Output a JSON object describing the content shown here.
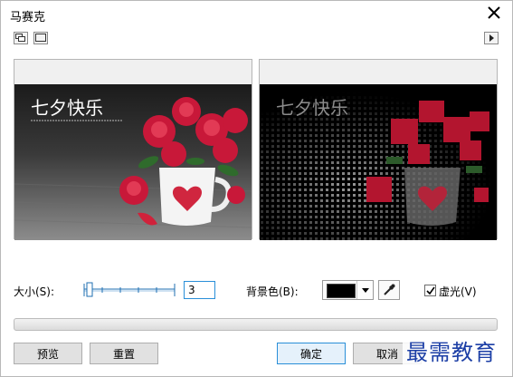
{
  "window": {
    "title": "马赛克"
  },
  "preview_left": {
    "overlay_text": "七夕快乐"
  },
  "preview_right": {
    "overlay_text": "七夕快乐"
  },
  "controls": {
    "size_label": "大小(S):",
    "size_value": "3",
    "bg_label": "背景色(B):",
    "bg_color": "#000000",
    "vignette_label": "虚光(V)",
    "vignette_checked": true
  },
  "buttons": {
    "preview": "预览",
    "reset": "重置",
    "ok": "确定",
    "cancel": "取消"
  },
  "watermark": "最需教育"
}
